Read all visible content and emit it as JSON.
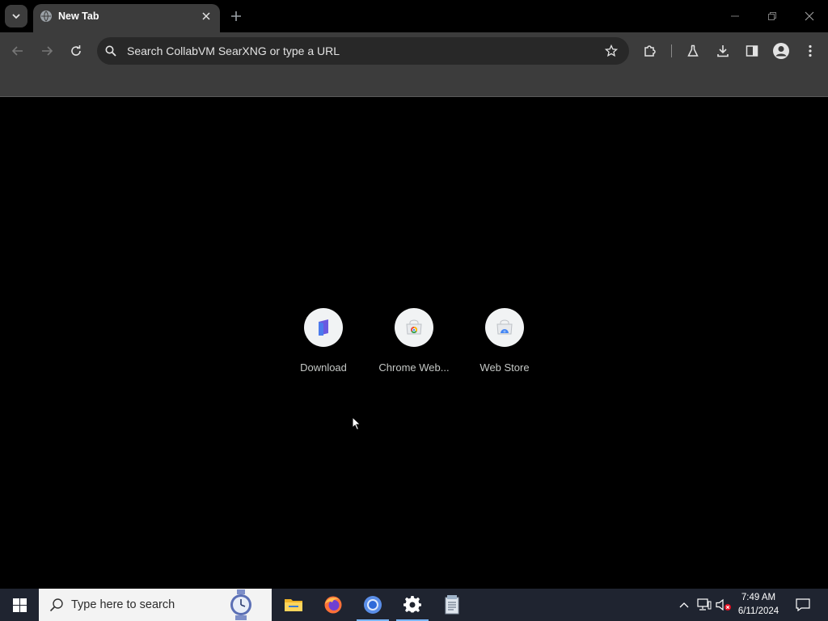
{
  "browser": {
    "tab": {
      "title": "New Tab",
      "favicon": "globe-icon",
      "close_icon": "close-icon"
    },
    "tab_search_icon": "chevron-down-icon",
    "new_tab_icon": "plus-icon",
    "window_controls": [
      "minimize-icon",
      "restore-icon",
      "close-icon"
    ],
    "toolbar": {
      "back_icon": "back-arrow-icon",
      "forward_icon": "forward-arrow-icon",
      "reload_icon": "reload-icon",
      "omnibox": {
        "placeholder": "Search CollabVM SearXNG or type a URL",
        "icon": "search-icon",
        "bookmark_icon": "star-icon"
      },
      "extensions_icon": "puzzle-icon",
      "labs_icon": "flask-icon",
      "downloads_icon": "download-icon",
      "side_panel_icon": "side-panel-icon",
      "profile_icon": "avatar-icon",
      "menu_icon": "kebab-menu-icon"
    }
  },
  "new_tab_page": {
    "shortcuts": [
      {
        "label": "Download",
        "icon": "download-site-icon"
      },
      {
        "label": "Chrome Web...",
        "icon": "chrome-web-store-icon"
      },
      {
        "label": "Web Store",
        "icon": "web-store-icon"
      }
    ]
  },
  "taskbar": {
    "start_icon": "windows-icon",
    "search": {
      "placeholder": "Type here to search",
      "icon": "search-icon",
      "badge_icon": "stopwatch-icon"
    },
    "apps": [
      {
        "name": "file-explorer-icon",
        "active": false
      },
      {
        "name": "firefox-icon",
        "active": false
      },
      {
        "name": "chrome-icon",
        "active": true
      },
      {
        "name": "settings-icon",
        "active": true
      },
      {
        "name": "notepad-icon",
        "active": false
      }
    ],
    "tray": {
      "chevron_icon": "chevron-up-icon",
      "network_icon": "network-icon",
      "volume_icon": "volume-muted-icon"
    },
    "clock": {
      "time": "7:49 AM",
      "date": "6/11/2024"
    },
    "notification_icon": "notification-icon"
  }
}
